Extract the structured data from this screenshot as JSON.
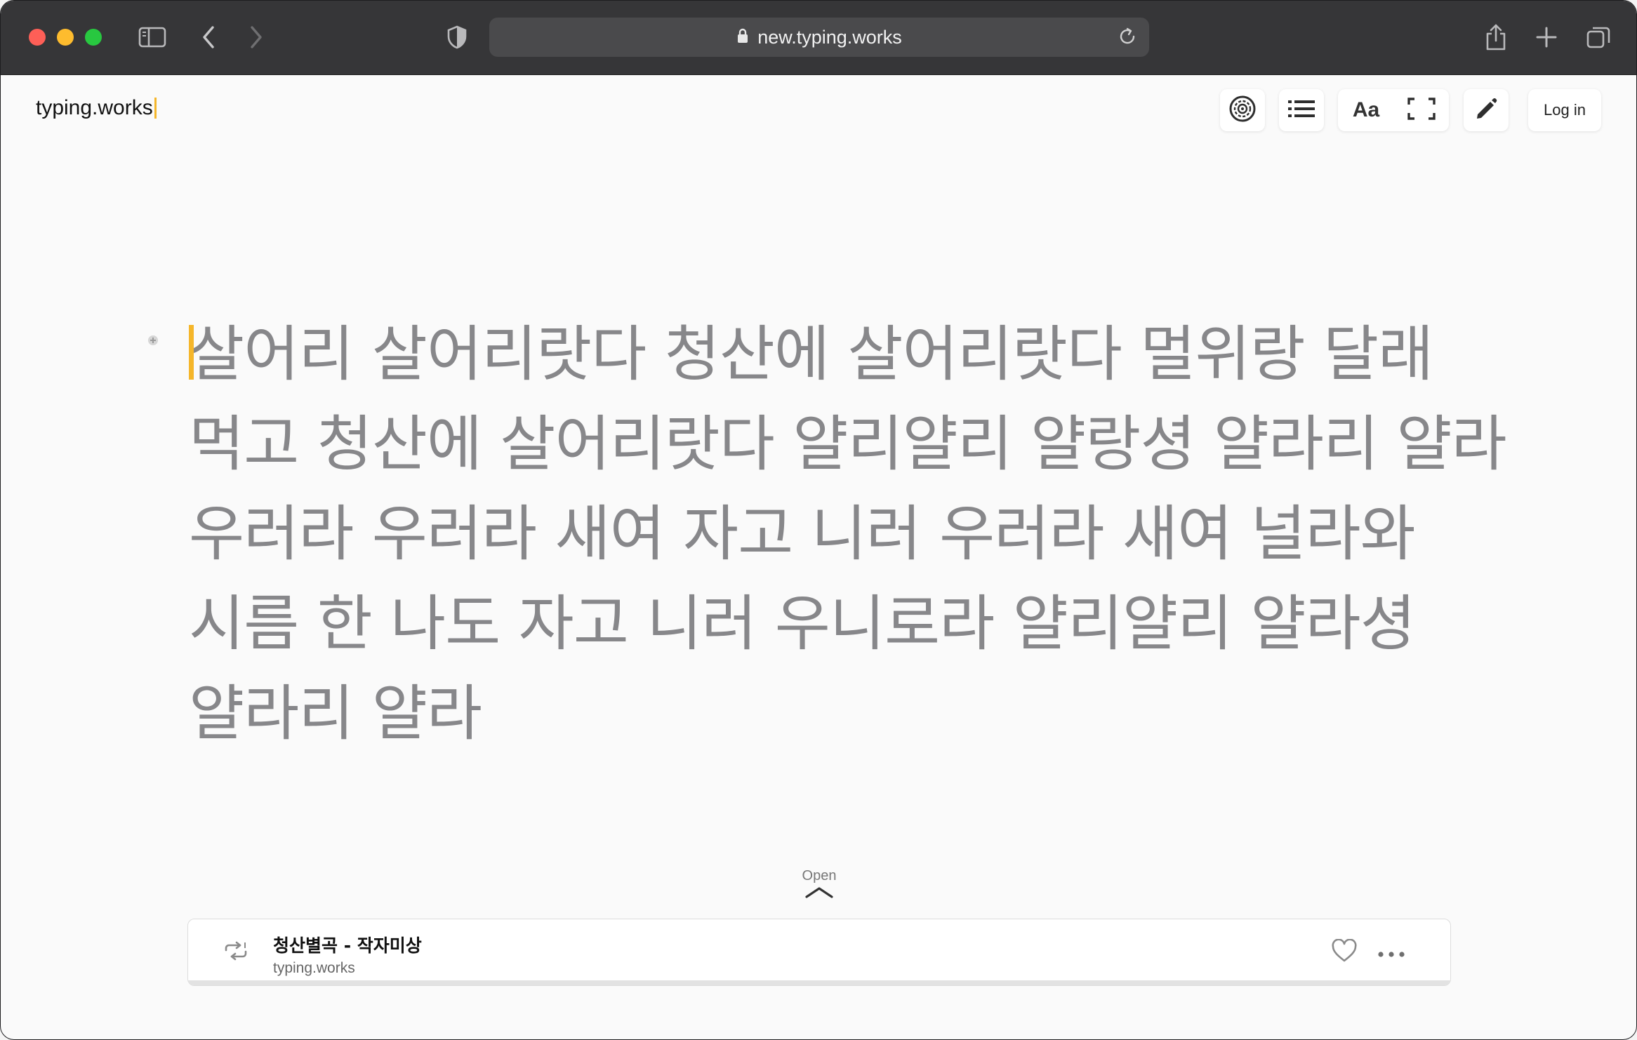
{
  "browser": {
    "url": "new.typing.works",
    "colors": {
      "chrome": "#363638",
      "urlbar": "#4a4a4c",
      "red": "#fe5f57",
      "yellow": "#febc2e",
      "green": "#28c840"
    },
    "icons": [
      "sidebar-icon",
      "back-icon",
      "forward-icon",
      "shield-icon",
      "lock-icon",
      "reload-icon",
      "share-icon",
      "new-tab-icon",
      "tabs-icon"
    ]
  },
  "header": {
    "brand": "typing.works",
    "login_label": "Log in",
    "font_button_label": "Aa",
    "icons": [
      "settings-icon",
      "list-icon",
      "fullscreen-icon",
      "pencil-icon"
    ],
    "accent": "#f5b62a"
  },
  "typing": {
    "lines": [
      "살어리 살어리랏다 청산에 살어리랏다 멀위랑 달래",
      "먹고 청산에 살어리랏다 얄리얄리 얄랑셩 얄라리 얄라",
      "우러라 우러라 새여 자고 니러 우러라 새여 널라와",
      "시름 한 나도 자고 니러 우니로라 얄리얄리 얄라셩",
      "얄라리 얄라"
    ],
    "text_color": "#87878a"
  },
  "player": {
    "open_label": "Open",
    "title": "청산별곡 - 작자미상",
    "source": "typing.works",
    "icons": [
      "repeat-one-icon",
      "heart-icon",
      "more-icon"
    ]
  }
}
